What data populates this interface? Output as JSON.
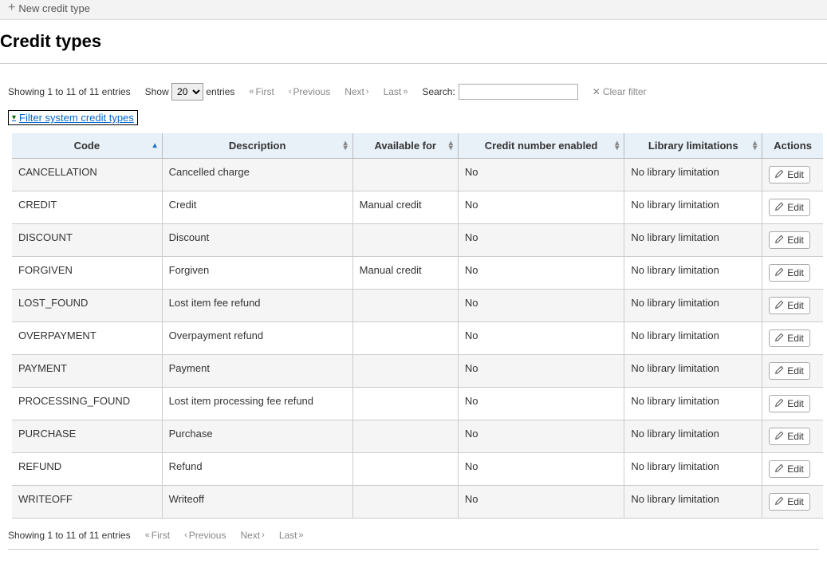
{
  "toolbar": {
    "new_label": "New credit type"
  },
  "page_title": "Credit types",
  "controls": {
    "showing_text": "Showing 1 to 11 of 11 entries",
    "show_pre": "Show",
    "show_post": "entries",
    "show_value": "20",
    "first": "First",
    "previous": "Previous",
    "next": "Next",
    "last": "Last",
    "search_label": "Search:",
    "search_value": "",
    "clear_filter": "Clear filter"
  },
  "filter_link": "Filter system credit types",
  "columns": {
    "code": "Code",
    "description": "Description",
    "available_for": "Available for",
    "credit_number_enabled": "Credit number enabled",
    "library_limitations": "Library limitations",
    "actions": "Actions"
  },
  "edit_label": "Edit",
  "rows": [
    {
      "code": "CANCELLATION",
      "description": "Cancelled charge",
      "available_for": "",
      "credit_number_enabled": "No",
      "library_limitations": "No library limitation"
    },
    {
      "code": "CREDIT",
      "description": "Credit",
      "available_for": "Manual credit",
      "credit_number_enabled": "No",
      "library_limitations": "No library limitation"
    },
    {
      "code": "DISCOUNT",
      "description": "Discount",
      "available_for": "",
      "credit_number_enabled": "No",
      "library_limitations": "No library limitation"
    },
    {
      "code": "FORGIVEN",
      "description": "Forgiven",
      "available_for": "Manual credit",
      "credit_number_enabled": "No",
      "library_limitations": "No library limitation"
    },
    {
      "code": "LOST_FOUND",
      "description": "Lost item fee refund",
      "available_for": "",
      "credit_number_enabled": "No",
      "library_limitations": "No library limitation"
    },
    {
      "code": "OVERPAYMENT",
      "description": "Overpayment refund",
      "available_for": "",
      "credit_number_enabled": "No",
      "library_limitations": "No library limitation"
    },
    {
      "code": "PAYMENT",
      "description": "Payment",
      "available_for": "",
      "credit_number_enabled": "No",
      "library_limitations": "No library limitation"
    },
    {
      "code": "PROCESSING_FOUND",
      "description": "Lost item processing fee refund",
      "available_for": "",
      "credit_number_enabled": "No",
      "library_limitations": "No library limitation"
    },
    {
      "code": "PURCHASE",
      "description": "Purchase",
      "available_for": "",
      "credit_number_enabled": "No",
      "library_limitations": "No library limitation"
    },
    {
      "code": "REFUND",
      "description": "Refund",
      "available_for": "",
      "credit_number_enabled": "No",
      "library_limitations": "No library limitation"
    },
    {
      "code": "WRITEOFF",
      "description": "Writeoff",
      "available_for": "",
      "credit_number_enabled": "No",
      "library_limitations": "No library limitation"
    }
  ]
}
